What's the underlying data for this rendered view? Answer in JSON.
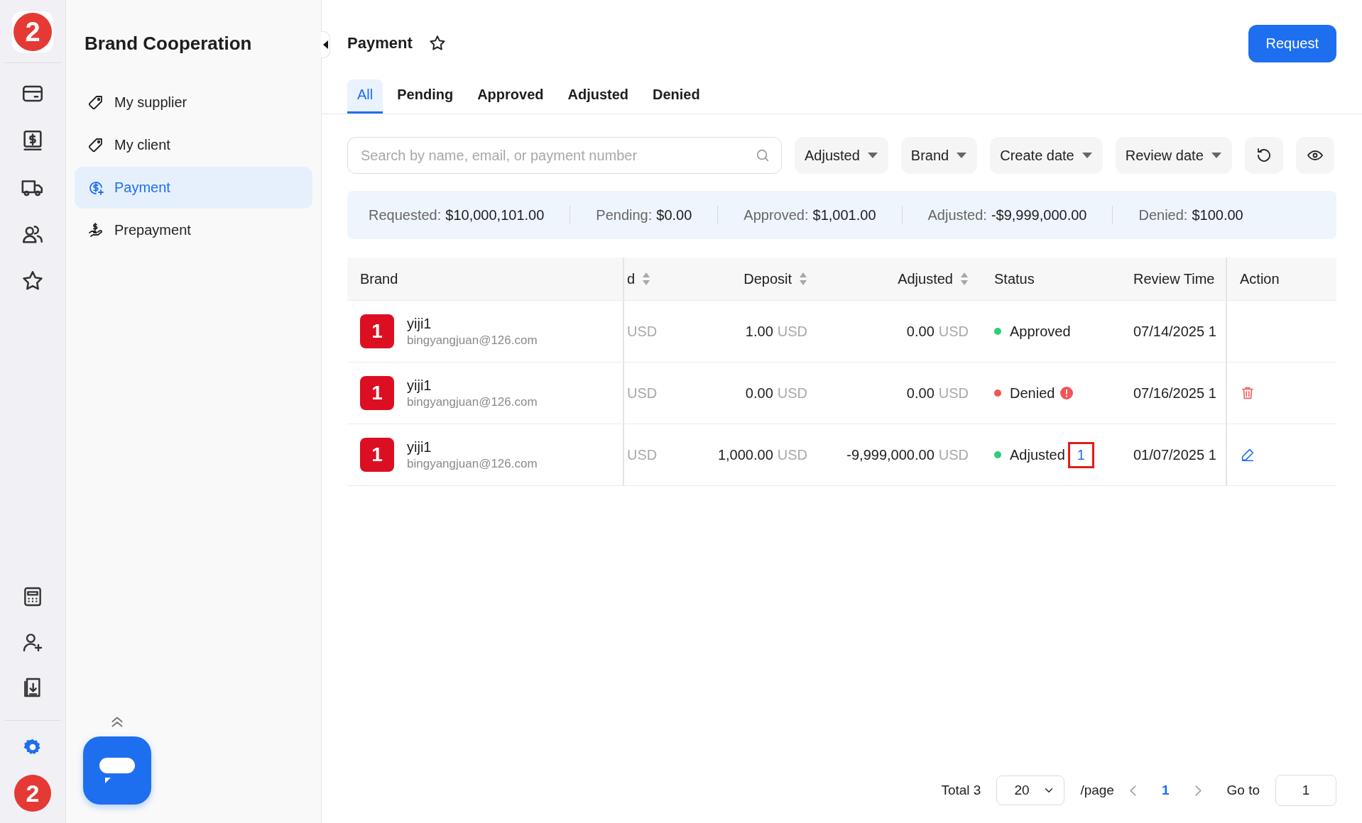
{
  "rail": {
    "logo": "2",
    "top_icons": [
      {
        "kind": "card"
      },
      {
        "kind": "dollar"
      },
      {
        "kind": "truck"
      },
      {
        "kind": "users"
      },
      {
        "kind": "star"
      }
    ],
    "bottom_icons": [
      {
        "kind": "calculator"
      },
      {
        "kind": "user-add"
      },
      {
        "kind": "download"
      }
    ],
    "avatar": "2"
  },
  "sidebar": {
    "title": "Brand Cooperation",
    "items": [
      {
        "label": "My supplier",
        "kind": "tag",
        "selected": false
      },
      {
        "label": "My client",
        "kind": "tag",
        "selected": false
      },
      {
        "label": "Payment",
        "kind": "payment",
        "selected": true
      },
      {
        "label": "Prepayment",
        "kind": "hand",
        "selected": false
      }
    ]
  },
  "header": {
    "title": "Payment",
    "favorite": false,
    "request_button": "Request"
  },
  "tabs": [
    {
      "label": "All",
      "selected": true
    },
    {
      "label": "Pending",
      "selected": false
    },
    {
      "label": "Approved",
      "selected": false
    },
    {
      "label": "Adjusted",
      "selected": false
    },
    {
      "label": "Denied",
      "selected": false
    }
  ],
  "search": {
    "placeholder": "Search by name, email, or payment number"
  },
  "filters": [
    "Adjusted",
    "Brand",
    "Create date",
    "Review date"
  ],
  "summary": [
    {
      "label": "Requested:",
      "value": "$10,000,101.00"
    },
    {
      "label": "Pending:",
      "value": "$0.00"
    },
    {
      "label": "Approved:",
      "value": "$1,001.00"
    },
    {
      "label": "Adjusted:",
      "value": "-$9,999,000.00"
    },
    {
      "label": "Denied:",
      "value": "$100.00"
    }
  ],
  "table": {
    "columns": [
      {
        "label": "Brand",
        "sortable": false
      },
      {
        "label": "d",
        "sortable": true
      },
      {
        "label": "Deposit",
        "sortable": true
      },
      {
        "label": "Adjusted",
        "sortable": true
      },
      {
        "label": "Status",
        "sortable": false
      },
      {
        "label": "Review Time",
        "sortable": false
      },
      {
        "label": "Action",
        "sortable": false
      }
    ],
    "rows": [
      {
        "logo": "1",
        "brand": "yiji1",
        "email": "bingyangjuan@126.com",
        "column_2": "USD",
        "deposit": "1.00",
        "deposit_currency": "USD",
        "adjusted": "0.00",
        "adjusted_currency": "USD",
        "status": "Approved",
        "color": "#2fcc7a",
        "alert": false,
        "review_time": "07/14/2025 1",
        "kind": "none"
      },
      {
        "logo": "1",
        "brand": "yiji1",
        "email": "bingyangjuan@126.com",
        "column_2": "USD",
        "deposit": "0.00",
        "deposit_currency": "USD",
        "adjusted": "0.00",
        "adjusted_currency": "USD",
        "status": "Denied",
        "color": "#f25555",
        "alert": true,
        "review_time": "07/16/2025 1",
        "kind": "delete"
      },
      {
        "logo": "1",
        "brand": "yiji1",
        "email": "bingyangjuan@126.com",
        "column_2": "USD",
        "deposit": "1,000.00",
        "deposit_currency": "USD",
        "adjusted": "-9,999,000.00",
        "adjusted_currency": "USD",
        "status": "Adjusted",
        "adjust_count": "1",
        "color": "#2fcc7a",
        "alert": false,
        "review_time": "01/07/2025 1",
        "kind": "edit"
      }
    ]
  },
  "pagination": {
    "total": "Total 3",
    "page_size": "20",
    "per_page": "/page",
    "pages": [
      {
        "label": "1",
        "selected": true
      }
    ],
    "goto_label": "Go to",
    "goto_value": "1"
  }
}
